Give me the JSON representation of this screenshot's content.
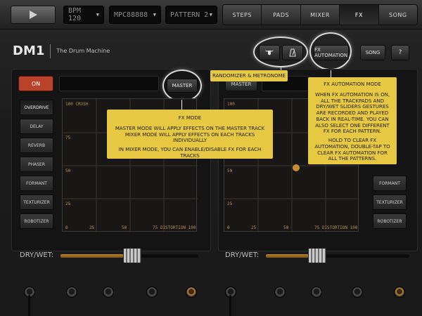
{
  "topbar": {
    "play_icon": "play-icon",
    "bpm": {
      "value": "BPM 120"
    },
    "mpc": {
      "value": "MPC88888"
    },
    "pattern": {
      "value": "PATTERN 2"
    },
    "tabs": [
      {
        "label": "STEPS"
      },
      {
        "label": "PADS"
      },
      {
        "label": "MIXER"
      },
      {
        "label": "FX",
        "active": true
      },
      {
        "label": "SONG"
      }
    ]
  },
  "header": {
    "logo": "DM1",
    "subtitle": "The Drum Machine",
    "randomizer_icon": "bull-icon",
    "metronome_icon": "metronome-icon",
    "fx_automation_label": "FX AUTOMATION",
    "song_label": "SONG",
    "help_label": "?"
  },
  "left_panel": {
    "on_label": "ON",
    "master_label": "MASTER",
    "fx_items": [
      "OVERDRIVE",
      "DELAY",
      "REVERB",
      "PHASER",
      "FORMANT",
      "TEXTURIZER",
      "ROBOTIZER"
    ],
    "active_fx": "OVERDRIVE",
    "pad": {
      "y_title": "100 CRUSH",
      "y_ticks": [
        "75",
        "50",
        "25",
        "0"
      ],
      "x_ticks": [
        "25",
        "50"
      ],
      "x_title": "75 DISTORTION 100"
    },
    "drywet_label": "DRY/WET:",
    "drywet_value": 0.52
  },
  "right_panel": {
    "master_label": "MASTER",
    "fx_items": [
      "FORMANT",
      "TEXTURIZER",
      "ROBOTIZER"
    ],
    "pad": {
      "y_title": "100",
      "y_ticks": [
        "75",
        "50",
        "25",
        "0"
      ],
      "x_ticks": [
        "25",
        "50"
      ],
      "x_title": "75 DISTORTION 100"
    },
    "drywet_label": "DRY/WET:",
    "drywet_value": 0.36
  },
  "tooltips": {
    "randomizer": "RANDOMIZER & METRONOME",
    "fx_mode": {
      "title": "FX MODE",
      "line1": "MASTER MODE WILL APPLY EFFECTS ON THE MASTER TRACK",
      "line2": "MIXER MODE WILL APPLY EFFECTS ON EACH TRACKS INDIVIDUALLY",
      "line3": "IN MIXER MODE, YOU CAN ENABLE/DISABLE FX FOR EACH TRACKS"
    },
    "fx_automation": {
      "title": "FX AUTOMATION MODE",
      "para1": "WHEN FX AUTOMATION IS ON, ALL THE TRACKPADS AND DRY/WET SLIDERS GESTURES ARE RECORDED AND PLAYED BACK IN REAL-TIME. YOU CAN ALSO SELECT ONE DIFFERENT FX FOR EACH PATTERN.",
      "para2": "HOLD TO CLEAR FX AUTOMATION, DOUBLE-TAP TO CLEAR FX AUTOMATION FOR ALL THE PATTERNS."
    }
  },
  "colors": {
    "accent_orange": "#c98a31",
    "tooltip_yellow": "#e7c842",
    "on_red": "#b8422a"
  }
}
